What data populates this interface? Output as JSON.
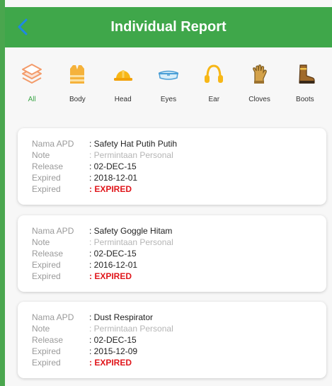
{
  "header": {
    "title": "Individual Report"
  },
  "categories": [
    {
      "label": "All",
      "icon": "layers-icon",
      "active": true
    },
    {
      "label": "Body",
      "icon": "vest-icon"
    },
    {
      "label": "Head",
      "icon": "hardhat-icon"
    },
    {
      "label": "Eyes",
      "icon": "goggles-icon"
    },
    {
      "label": "Ear",
      "icon": "earmuffs-icon"
    },
    {
      "label": "Cloves",
      "icon": "glove-icon"
    },
    {
      "label": "Boots",
      "icon": "boot-icon"
    }
  ],
  "field_labels": {
    "nama_apd": "Nama APD",
    "note": "Note",
    "release": "Release",
    "expired": "Expired",
    "expired_status": "Expired"
  },
  "reports": [
    {
      "nama_apd": ": Safety Hat Putih Putih",
      "note": ": Permintaan Personal",
      "release": ": 02-DEC-15",
      "expired": ": 2018-12-01",
      "status": ": EXPIRED"
    },
    {
      "nama_apd": ": Safety Goggle Hitam",
      "note": ": Permintaan Personal",
      "release": ": 02-DEC-15",
      "expired": ": 2016-12-01",
      "status": ": EXPIRED"
    },
    {
      "nama_apd": ": Dust Respirator",
      "note": ": Permintaan Personal",
      "release": ": 02-DEC-15",
      "expired": ": 2015-12-09",
      "status": ": EXPIRED"
    }
  ],
  "colors": {
    "brand_green": "#3fa74a",
    "expired_red": "#e0161b"
  }
}
